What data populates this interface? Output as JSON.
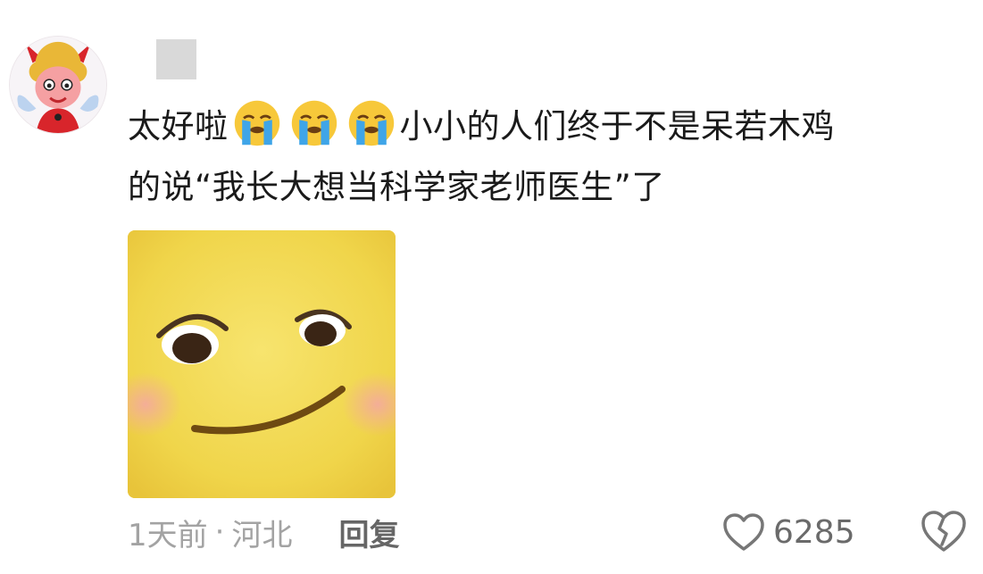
{
  "comment": {
    "text_parts": [
      "太好啦",
      "小小的人们终于不是呆若木鸡",
      "的说“我长大想当科学家老师医生”了"
    ],
    "emoji_name": "loudly-crying-face",
    "meta": {
      "time": "1天前",
      "dot": "·",
      "location": "河北",
      "reply_label": "回复"
    },
    "likes": "6285"
  },
  "icons": {
    "like": "heart-outline-icon",
    "dislike": "broken-heart-icon"
  },
  "colors": {
    "text": "#1a1a1a",
    "meta": "#a3a3a3",
    "reply": "#666666",
    "sticker_yellow": "#f2d852"
  }
}
